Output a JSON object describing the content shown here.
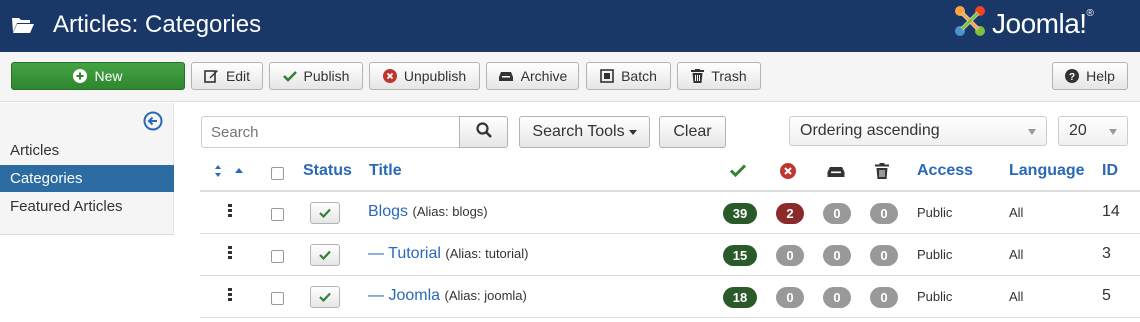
{
  "header": {
    "title": "Articles: Categories",
    "logo_text": "Joomla!",
    "logo_mark": "®",
    "bg_color": "#1a3867"
  },
  "toolbar": {
    "new_label": "New",
    "edit_label": "Edit",
    "publish_label": "Publish",
    "unpublish_label": "Unpublish",
    "archive_label": "Archive",
    "batch_label": "Batch",
    "trash_label": "Trash",
    "help_label": "Help"
  },
  "sidebar": {
    "items": [
      {
        "label": "Articles",
        "active": false
      },
      {
        "label": "Categories",
        "active": true
      },
      {
        "label": "Featured Articles",
        "active": false
      }
    ]
  },
  "filters": {
    "search_placeholder": "Search",
    "search_tools_label": "Search Tools",
    "clear_label": "Clear",
    "ordering_value": "Ordering ascending",
    "limit_value": "20"
  },
  "table": {
    "headers": {
      "status": "Status",
      "title": "Title",
      "access": "Access",
      "language": "Language",
      "id": "ID"
    },
    "rows": [
      {
        "title": "Blogs",
        "prefix": "",
        "alias": "(Alias: blogs)",
        "published": "39",
        "unpublished": "2",
        "archived": "0",
        "trashed": "0",
        "access": "Public",
        "language": "All",
        "id": "14"
      },
      {
        "title": "Tutorial",
        "prefix": "— ",
        "alias": "(Alias: tutorial)",
        "published": "15",
        "unpublished": "0",
        "archived": "0",
        "trashed": "0",
        "access": "Public",
        "language": "All",
        "id": "3"
      },
      {
        "title": "Joomla",
        "prefix": "— ",
        "alias": "(Alias: joomla)",
        "published": "18",
        "unpublished": "0",
        "archived": "0",
        "trashed": "0",
        "access": "Public",
        "language": "All",
        "id": "5"
      }
    ]
  },
  "colors": {
    "accent": "#2a69b8",
    "published_badge": "#2a5a2a",
    "unpublished_badge": "#8b2a2a",
    "zero_badge": "#999999",
    "active_sidebar": "#2d6ca2"
  }
}
